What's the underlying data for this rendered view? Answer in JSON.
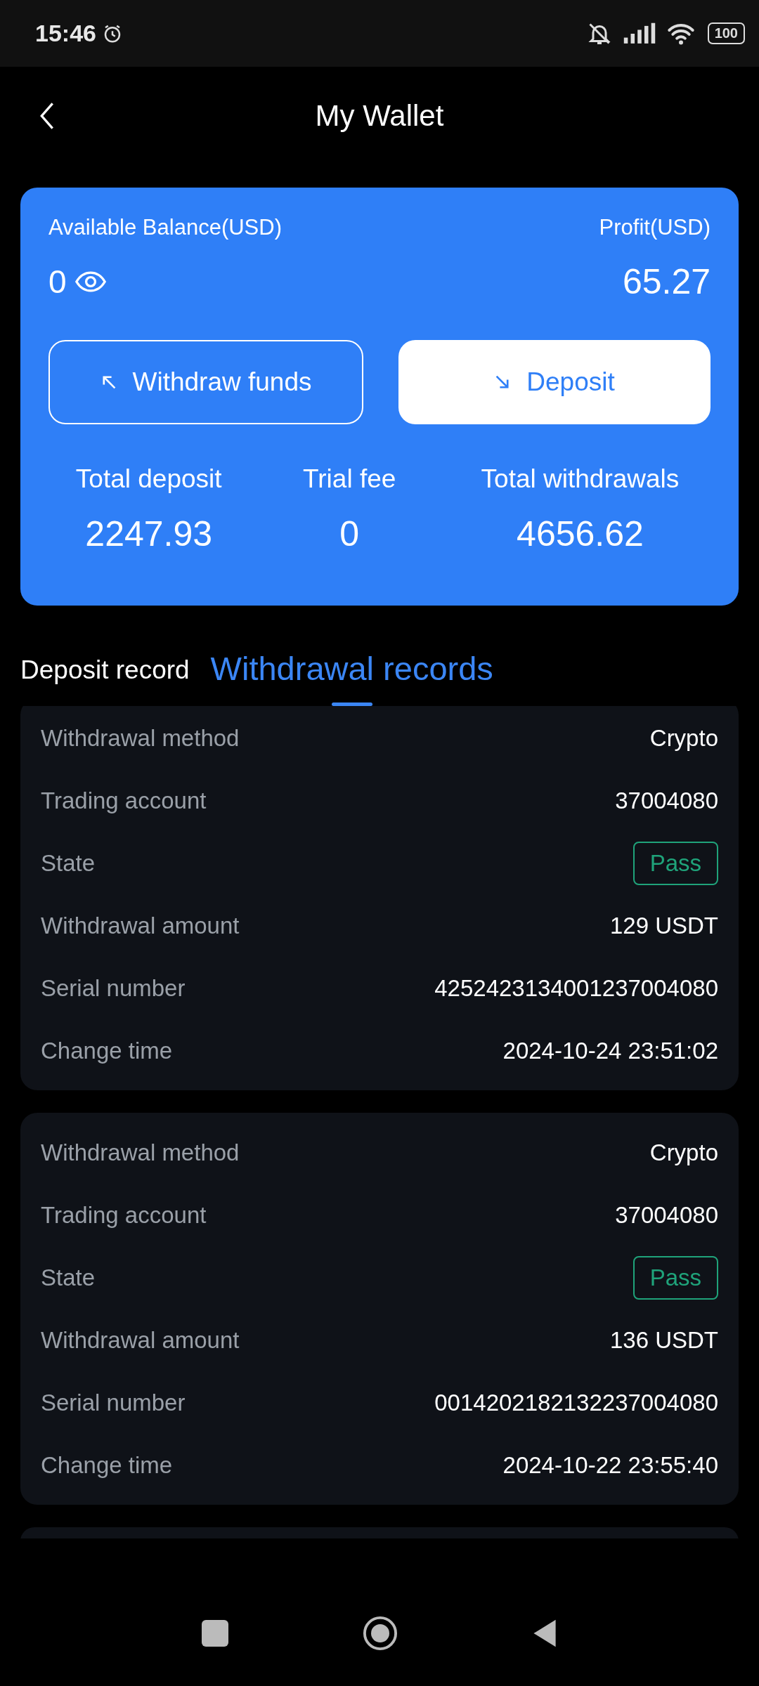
{
  "status_bar": {
    "time": "15:46",
    "battery": "100"
  },
  "header": {
    "title": "My Wallet"
  },
  "balance": {
    "label": "Available Balance(USD)",
    "value": "0",
    "profit_label": "Profit(USD)",
    "profit": "65.27"
  },
  "actions": [
    {
      "label": "Withdraw funds",
      "kind": "outline"
    },
    {
      "label": "Deposit",
      "kind": "filled"
    }
  ],
  "stats": [
    {
      "label": "Total deposit",
      "value": "2247.93"
    },
    {
      "label": "Trial fee",
      "value": "0"
    },
    {
      "label": "Total withdrawals",
      "value": "4656.62"
    }
  ],
  "tabs": [
    {
      "label": "Deposit record",
      "selected": false
    },
    {
      "label": "Withdrawal records",
      "selected": true
    }
  ],
  "records": [
    {
      "rows": [
        {
          "label": "Withdrawal method",
          "value": "Crypto",
          "kind": "text"
        },
        {
          "label": "Trading account",
          "value": "37004080",
          "kind": "text"
        },
        {
          "label": "State",
          "value": "Pass",
          "kind": "badge"
        },
        {
          "label": "Withdrawal amount",
          "value": "129 USDT",
          "kind": "text"
        },
        {
          "label": "Serial number",
          "value": "4252423134001237004080",
          "kind": "text"
        },
        {
          "label": "Change time",
          "value": "2024-10-24 23:51:02",
          "kind": "text"
        }
      ]
    },
    {
      "rows": [
        {
          "label": "Withdrawal method",
          "value": "Crypto",
          "kind": "text"
        },
        {
          "label": "Trading account",
          "value": "37004080",
          "kind": "text"
        },
        {
          "label": "State",
          "value": "Pass",
          "kind": "badge"
        },
        {
          "label": "Withdrawal amount",
          "value": "136 USDT",
          "kind": "text"
        },
        {
          "label": "Serial number",
          "value": "0014202182132237004080",
          "kind": "text"
        },
        {
          "label": "Change time",
          "value": "2024-10-22 23:55:40",
          "kind": "text"
        }
      ]
    }
  ]
}
